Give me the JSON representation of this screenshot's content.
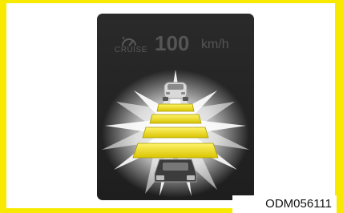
{
  "display": {
    "cruise_label": "CRUISE",
    "speed_value": "100",
    "speed_unit": "km/h"
  },
  "icons": {
    "cruise": "cruise-speedometer-icon",
    "front_car": "front-car-icon",
    "own_car": "own-car-icon"
  },
  "distance_bars": {
    "count": 4,
    "color": "#e8d800"
  },
  "figure_code": "ODM056111",
  "colors": {
    "border": "#f7ea00",
    "panel": "#252525",
    "dim_text": "#555555"
  }
}
